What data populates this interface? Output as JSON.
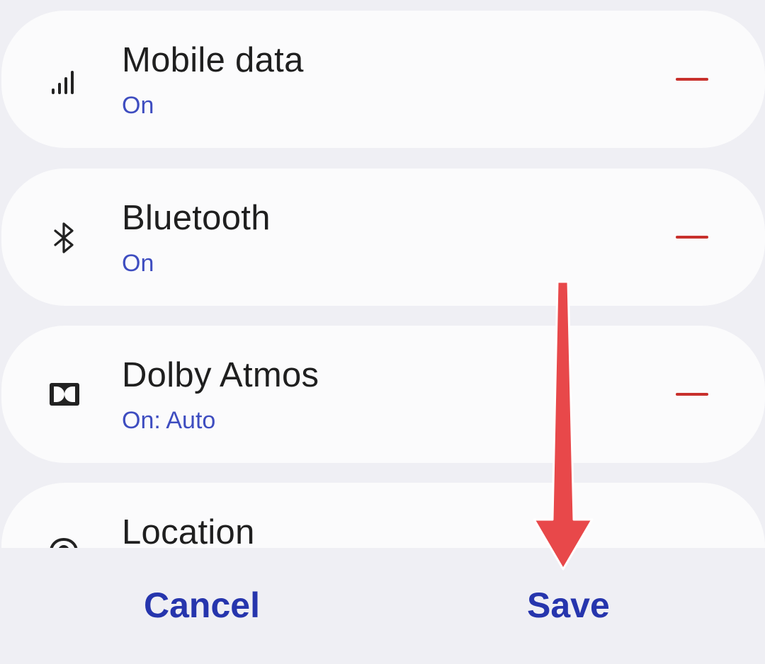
{
  "tiles": [
    {
      "title": "Mobile data",
      "status": "On",
      "icon": "signal-bars-icon"
    },
    {
      "title": "Bluetooth",
      "status": "On",
      "icon": "bluetooth-icon"
    },
    {
      "title": "Dolby Atmos",
      "status": "On: Auto",
      "icon": "dolby-icon"
    },
    {
      "title": "Location",
      "status": "",
      "icon": "location-icon"
    }
  ],
  "footer": {
    "cancel_label": "Cancel",
    "save_label": "Save"
  },
  "annotation": {
    "type": "arrow",
    "direction": "down",
    "points_to": "save-button"
  },
  "colors": {
    "background": "#efeff4",
    "card": "#fbfbfc",
    "title_text": "#1f1f1f",
    "status_text": "#3e4dc0",
    "remove_dash": "#c8302c",
    "button_text": "#2635ad",
    "arrow": "#e8484a"
  }
}
